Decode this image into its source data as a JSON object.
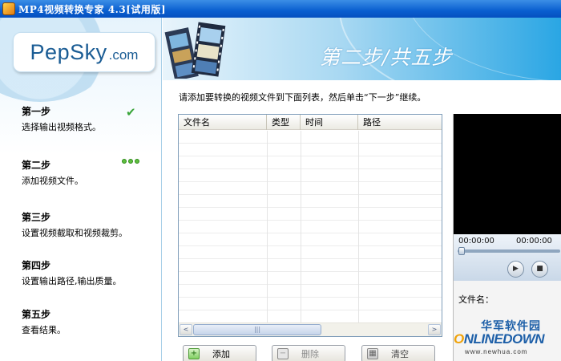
{
  "window": {
    "title": "MP4视频转换专家 4.3[试用版]"
  },
  "logo": {
    "brand": "PepSky",
    "suffix": ".com"
  },
  "steps": [
    {
      "title": "第一步",
      "desc": "选择输出视频格式。",
      "status": "done"
    },
    {
      "title": "第二步",
      "desc": "添加视频文件。",
      "status": "current"
    },
    {
      "title": "第三步",
      "desc": "设置视频截取和视频裁剪。",
      "status": "pending"
    },
    {
      "title": "第四步",
      "desc": "设置输出路径,输出质量。",
      "status": "pending"
    },
    {
      "title": "第五步",
      "desc": "查看结果。",
      "status": "pending"
    }
  ],
  "header": {
    "step_heading": "第二步/共五步"
  },
  "instruction": "请添加要转换的视频文件到下面列表，然后单击“下一步”继续。",
  "file_list": {
    "columns": [
      "文件名",
      "类型",
      "时间",
      "路径"
    ],
    "scroll_left": "<",
    "scroll_right": ">",
    "scroll_grip": "|||"
  },
  "buttons": {
    "add": "添加",
    "delete": "删除",
    "clear": "清空"
  },
  "player": {
    "time_start": "00:00:00",
    "time_end": "00:00:00",
    "filename_label": "文件名："
  },
  "watermark": {
    "cn": "华军软件园",
    "en_pre": "",
    "en_o": "O",
    "en_rest": "NLINEDOWN",
    "url": "www.newhua.com"
  },
  "colors": {
    "title_bar": "#0a5fd0",
    "accent": "#2aa6e4",
    "check": "#3aa53a"
  }
}
